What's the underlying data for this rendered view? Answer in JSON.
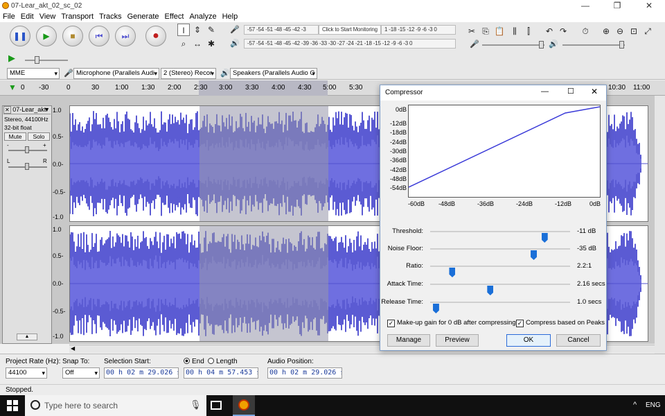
{
  "window": {
    "title": "07-Lear_akt_02_sc_02",
    "min": "—",
    "restore": "❐",
    "close": "✕"
  },
  "menu": [
    "File",
    "Edit",
    "View",
    "Transport",
    "Tracks",
    "Generate",
    "Effect",
    "Analyze",
    "Help"
  ],
  "transport": {
    "pause": "❚❚",
    "play": "▶",
    "stop": "■",
    "skip_start": "⏮",
    "skip_end": "⏭",
    "record": "●"
  },
  "meters": {
    "record": "-57 -54 -51 -48 -45 -42 -3",
    "record_tooltip": "Click to Start Monitoring",
    "record_right": "1 -18 -15 -12 -9 -6 -3 0",
    "playback": "-57 -54 -51 -48 -45 -42 -39 -36 -33 -30 -27 -24 -21 -18 -15 -12 -9 -6 -3 0",
    "mic_icon": "🎤",
    "speaker_icon": "🔊"
  },
  "devices": {
    "host": "MME",
    "mic": "Microphone (Parallels Audi",
    "channels": "2 (Stereo) Recor",
    "speaker": "Speakers (Parallels Audio C"
  },
  "ruler": {
    "ticks": [
      "0",
      "-30",
      "0",
      "30",
      "1:00",
      "1:30",
      "2:00",
      "2:30",
      "3:00",
      "3:30",
      "4:00",
      "4:30",
      "5:00",
      "5:30",
      "10:30",
      "11:00"
    ]
  },
  "track": {
    "name": "07-Lear_akt",
    "info1": "Stereo, 44100Hz",
    "info2": "32-bit float",
    "mute": "Mute",
    "solo": "Solo",
    "gain_minus": "-",
    "gain_plus": "+",
    "pan_l": "L",
    "pan_r": "R",
    "scale_top": [
      "1.0",
      "0.5-",
      "0.0-",
      "-0.5-",
      "-1.0"
    ],
    "scale_bottom": [
      "1.0",
      "0.5-",
      "0.0-",
      "-0.5-",
      "-1.0"
    ]
  },
  "selection_bar": {
    "project_rate_label": "Project Rate (Hz):",
    "project_rate": "44100",
    "snap_label": "Snap To:",
    "snap_value": "Off",
    "sel_start_label": "Selection Start:",
    "end_label": "End",
    "length_label": "Length",
    "sel_start": "00 h 02 m 29.026 s",
    "sel_end": "00 h 04 m 57.453 s",
    "audio_pos_label": "Audio Position:",
    "audio_pos": "00 h 02 m 29.026 s"
  },
  "status": "Stopped.",
  "taskbar": {
    "search": "Type here to search",
    "lang": "ENG"
  },
  "dialog": {
    "title": "Compressor",
    "y_labels": [
      "0dB",
      "-12dB",
      "-18dB",
      "-24dB",
      "-30dB",
      "-36dB",
      "-42dB",
      "-48dB",
      "-54dB"
    ],
    "x_labels": [
      "-60dB",
      "-48dB",
      "-36dB",
      "-24dB",
      "-12dB",
      "0dB"
    ],
    "sliders": [
      {
        "name": "Threshold:",
        "value": "-11 dB",
        "level": 0.82
      },
      {
        "name": "Noise Floor:",
        "value": "-35 dB",
        "level": 0.74
      },
      {
        "name": "Ratio:",
        "value": "2.2:1",
        "level": 0.14
      },
      {
        "name": "Attack Time:",
        "value": "2.16 secs",
        "level": 0.42
      },
      {
        "name": "Release Time:",
        "value": "1.0 secs",
        "level": 0.02
      }
    ],
    "makeup_label": "Make-up gain for 0 dB after compressing",
    "peaks_label": "Compress based on Peaks",
    "manage": "Manage",
    "preview": "Preview",
    "ok": "OK",
    "cancel": "Cancel"
  }
}
